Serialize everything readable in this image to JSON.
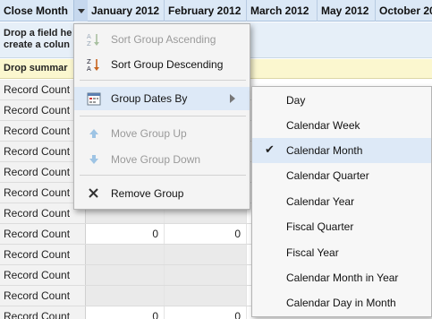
{
  "header": {
    "first_col": "Close Month",
    "months": [
      "January 2012",
      "February 2012",
      "March 2012",
      "May 2012",
      "October 20"
    ]
  },
  "help_text": {
    "line1": "Drop a field he",
    "line2": "create a colun"
  },
  "summary_text": "Drop summar",
  "rows": [
    {
      "label": "Record Count",
      "c1": "",
      "c2": ""
    },
    {
      "label": "Record Count",
      "c1": "",
      "c2": ""
    },
    {
      "label": "Record Count",
      "c1": "",
      "c2": ""
    },
    {
      "label": "Record Count",
      "c1": "",
      "c2": ""
    },
    {
      "label": "Record Count",
      "c1": "",
      "c2": ""
    },
    {
      "label": "Record Count",
      "c1": "",
      "c2": ""
    },
    {
      "label": "Record Count",
      "c1": "",
      "c2": ""
    },
    {
      "label": "Record Count",
      "c1": "0",
      "c2": "0"
    },
    {
      "label": "Record Count",
      "c1": "",
      "c2": ""
    },
    {
      "label": "Record Count",
      "c1": "",
      "c2": ""
    },
    {
      "label": "Record Count",
      "c1": "",
      "c2": ""
    },
    {
      "label": "Record Count",
      "c1": "0",
      "c2": "0"
    }
  ],
  "context_menu": {
    "sort_asc": "Sort Group Ascending",
    "sort_desc": "Sort Group Descending",
    "group_dates_by": "Group Dates By",
    "move_up": "Move Group Up",
    "move_down": "Move Group Down",
    "remove": "Remove Group",
    "icons": {
      "sort_asc": "sort-az-icon",
      "sort_desc": "sort-za-icon",
      "group_dates_by": "calendar-icon",
      "move_up": "arrow-up-icon",
      "move_down": "arrow-down-icon",
      "remove": "close-icon"
    }
  },
  "date_submenu": {
    "options": [
      "Day",
      "Calendar Week",
      "Calendar Month",
      "Calendar Quarter",
      "Calendar Year",
      "Fiscal Quarter",
      "Fiscal Year",
      "Calendar Month in Year",
      "Calendar Day in Month"
    ],
    "selected": "Calendar Month",
    "check_mark": "✔"
  },
  "colors": {
    "header_bg": "#dbe8f6",
    "summary_bg": "#fbf7cf",
    "menu_highlight": "#dde9f7"
  }
}
